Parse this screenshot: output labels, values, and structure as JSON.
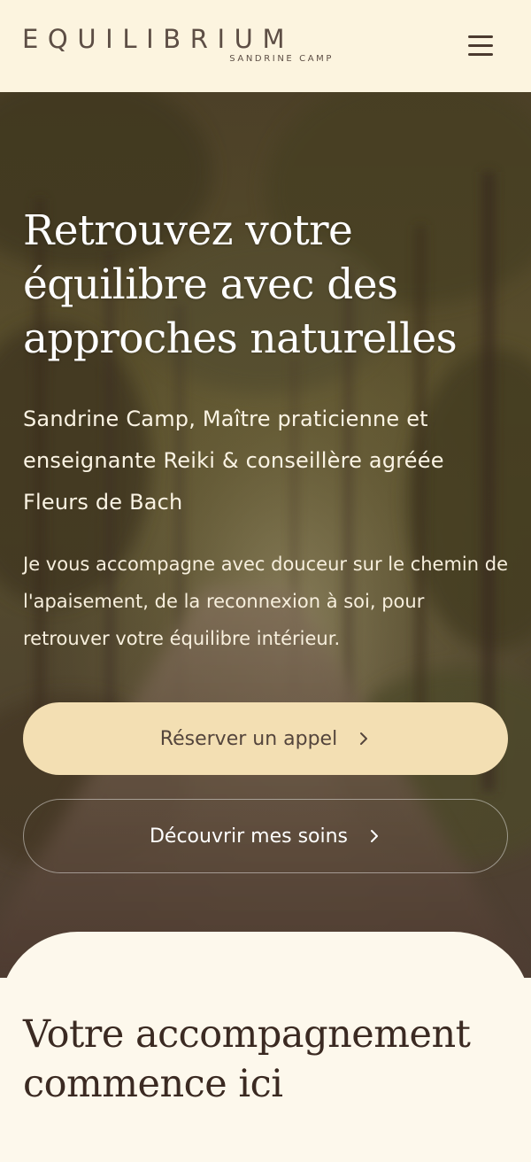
{
  "header": {
    "logo_main": "EQUILIBRIUM",
    "logo_sub": "SANDRINE CAMP",
    "menu_icon": "hamburger-menu-icon"
  },
  "hero": {
    "title": "Retrouvez votre équilibre avec des approches naturelles",
    "subtitle": "Sandrine Camp, Maître praticienne et enseignante Reiki & conseillère agréée Fleurs de Bach",
    "description": "Je vous accompagne avec douceur sur le chemin de l'apaisement, de la reconnexion à soi, pour retrouver votre équilibre intérieur.",
    "primary_button": "Réserver un appel",
    "secondary_button": "Découvrir mes soins",
    "chevron_icon": "chevron-right-icon",
    "background_image": "forest-path-photo"
  },
  "section": {
    "title": "Votre accompagnement commence ici"
  },
  "colors": {
    "header_bg": "#fcf4df",
    "primary_button_bg": "#f3dfb3",
    "text_dark": "#3b2a22",
    "page_bg": "#fdf8ec"
  }
}
